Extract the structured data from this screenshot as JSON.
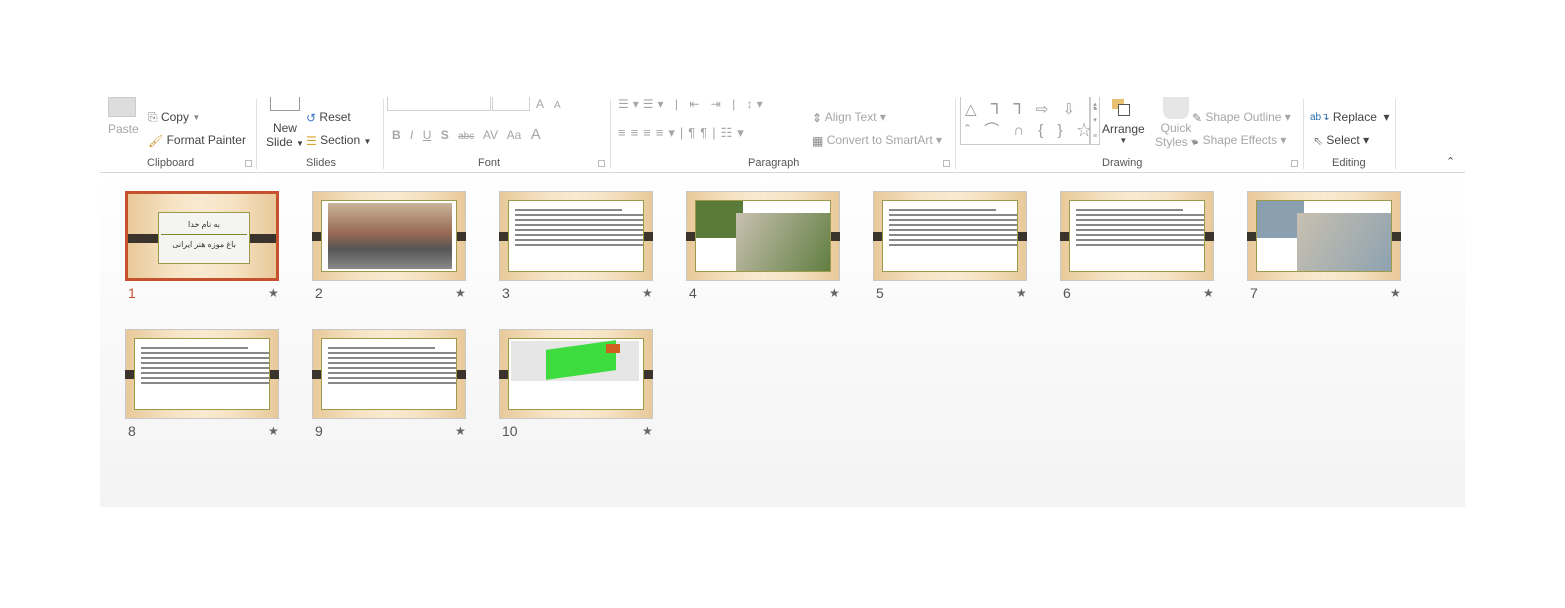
{
  "ribbon": {
    "clipboard": {
      "paste": "Paste",
      "copy": "Copy",
      "format_painter": "Format Painter",
      "label": "Clipboard"
    },
    "slides": {
      "new_slide_1": "New",
      "new_slide_2": "Slide",
      "reset": "Reset",
      "section": "Section",
      "label": "Slides"
    },
    "font": {
      "bold": "B",
      "italic": "I",
      "underline": "U",
      "shadow": "S",
      "strike": "abc",
      "spacing": "AV",
      "case": "Aa",
      "grow": "A",
      "shrink": "A",
      "color": "A",
      "label": "Font"
    },
    "paragraph": {
      "align_text": "Align Text",
      "convert_smartart": "Convert to SmartArt",
      "label": "Paragraph"
    },
    "drawing": {
      "shapes_glyphs": "△ ⅂ ⅂ ⇨ ⇩ ◔\nˆ ⌒ ∩ { } ☆",
      "arrange": "Arrange",
      "quick_1": "Quick",
      "quick_2": "Styles",
      "shape_outline": "Shape Outline",
      "shape_effects": "Shape Effects",
      "label": "Drawing"
    },
    "editing": {
      "replace": "Replace",
      "select": "Select",
      "label": "Editing"
    }
  },
  "slides": [
    {
      "number": "1",
      "selected": true,
      "title": "به نام خدا",
      "subtitle": "باغ موزه هنر ایرانی",
      "type": "title"
    },
    {
      "number": "2",
      "type": "photo",
      "color": "#8a6a5a"
    },
    {
      "number": "3",
      "type": "text"
    },
    {
      "number": "4",
      "type": "collage",
      "color": "#5a7a3a"
    },
    {
      "number": "5",
      "type": "text"
    },
    {
      "number": "6",
      "type": "text"
    },
    {
      "number": "7",
      "type": "collage",
      "color": "#8aa0b0"
    },
    {
      "number": "8",
      "type": "text"
    },
    {
      "number": "9",
      "type": "text"
    },
    {
      "number": "10",
      "type": "map",
      "color": "#3fdc3f"
    }
  ],
  "colors": {
    "selection": "#c5512f"
  }
}
